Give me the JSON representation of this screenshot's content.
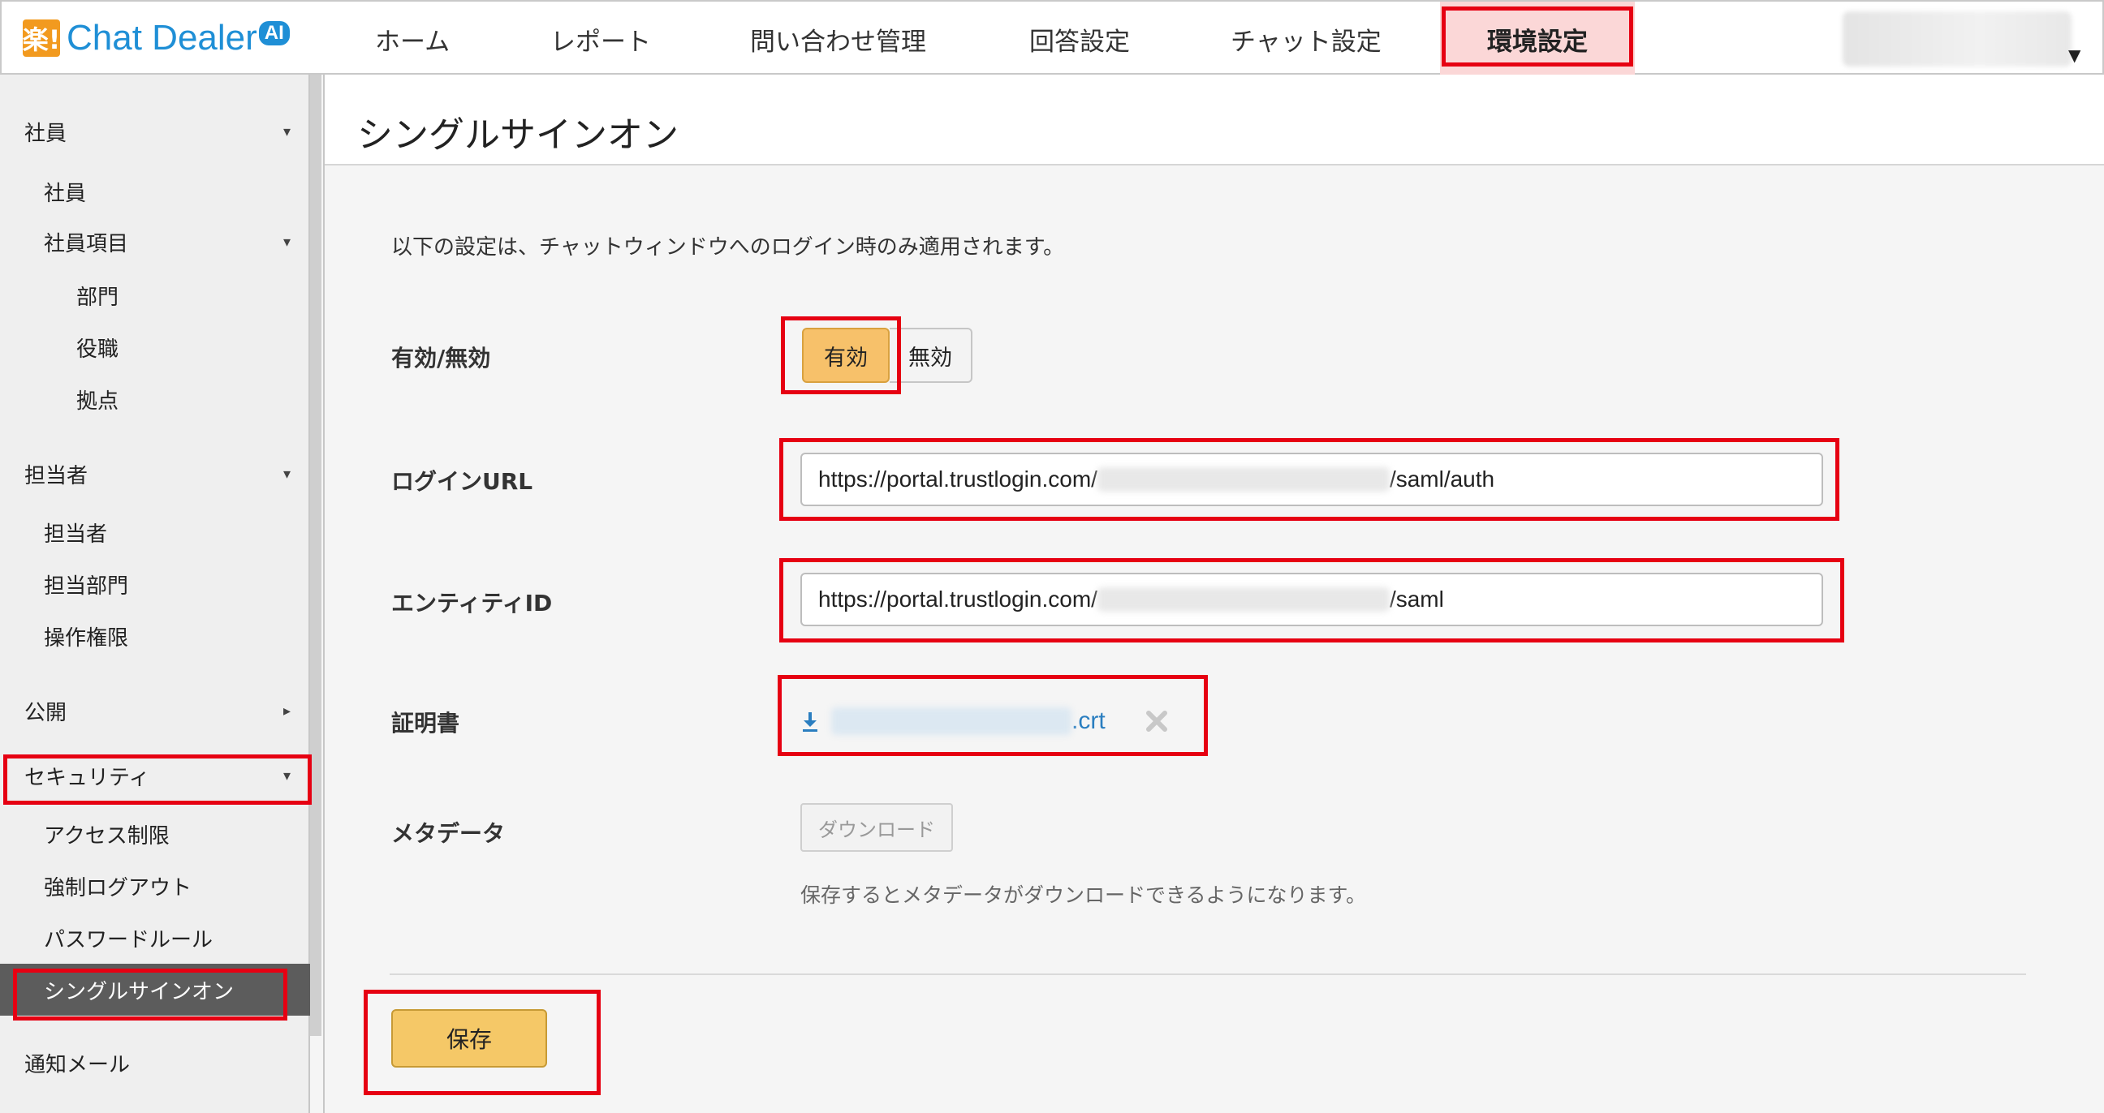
{
  "brand": {
    "logo_mark": "楽!",
    "name": "Chat Dealer",
    "badge": "AI"
  },
  "nav": {
    "items": [
      {
        "label": "ホーム"
      },
      {
        "label": "レポート"
      },
      {
        "label": "問い合わせ管理"
      },
      {
        "label": "回答設定"
      },
      {
        "label": "チャット設定"
      },
      {
        "label": "環境設定",
        "active": true
      }
    ]
  },
  "sidebar": {
    "items": [
      {
        "label": "社員",
        "level": 0,
        "caret": "▾"
      },
      {
        "label": "社員",
        "level": 1
      },
      {
        "label": "社員項目",
        "level": 1,
        "caret": "▾"
      },
      {
        "label": "部門",
        "level": 2
      },
      {
        "label": "役職",
        "level": 2
      },
      {
        "label": "拠点",
        "level": 2
      },
      {
        "label": "担当者",
        "level": 0,
        "caret": "▾"
      },
      {
        "label": "担当者",
        "level": 1
      },
      {
        "label": "担当部門",
        "level": 1
      },
      {
        "label": "操作権限",
        "level": 1
      },
      {
        "label": "公開",
        "level": 0,
        "caret": "▸"
      },
      {
        "label": "セキュリティ",
        "level": 0,
        "caret": "▾"
      },
      {
        "label": "アクセス制限",
        "level": 1
      },
      {
        "label": "強制ログアウト",
        "level": 1
      },
      {
        "label": "パスワードルール",
        "level": 1
      },
      {
        "label": "シングルサインオン",
        "level": 1,
        "selected": true
      },
      {
        "label": "通知メール",
        "level": 0
      }
    ]
  },
  "page": {
    "title": "シングルサインオン",
    "notice": "以下の設定は、チャットウィンドウへのログイン時のみ適用されます。",
    "enable": {
      "label": "有効/無効",
      "on_label": "有効",
      "off_label": "無効",
      "selected": "有効"
    },
    "login_url": {
      "label": "ログインURL",
      "prefix": "https://portal.trustlogin.com/",
      "suffix": "/saml/auth"
    },
    "entity_id": {
      "label": "エンティティID",
      "prefix": "https://portal.trustlogin.com/",
      "suffix": "/saml"
    },
    "certificate": {
      "label": "証明書",
      "file_suffix": ".crt",
      "icon": "download-icon",
      "remove_icon": "close-icon"
    },
    "metadata": {
      "label": "メタデータ",
      "button": "ダウンロード",
      "hint": "保存するとメタデータがダウンロードできるようになります。"
    },
    "save_button": "保存"
  },
  "colors": {
    "accent": "#f7c16a",
    "brand_blue": "#1f8fd6",
    "highlight_red": "#e60012",
    "link": "#2a7ec0",
    "active_nav_bg": "#fbd7d7",
    "selected_sidebar_bg": "#5c5c5c"
  }
}
